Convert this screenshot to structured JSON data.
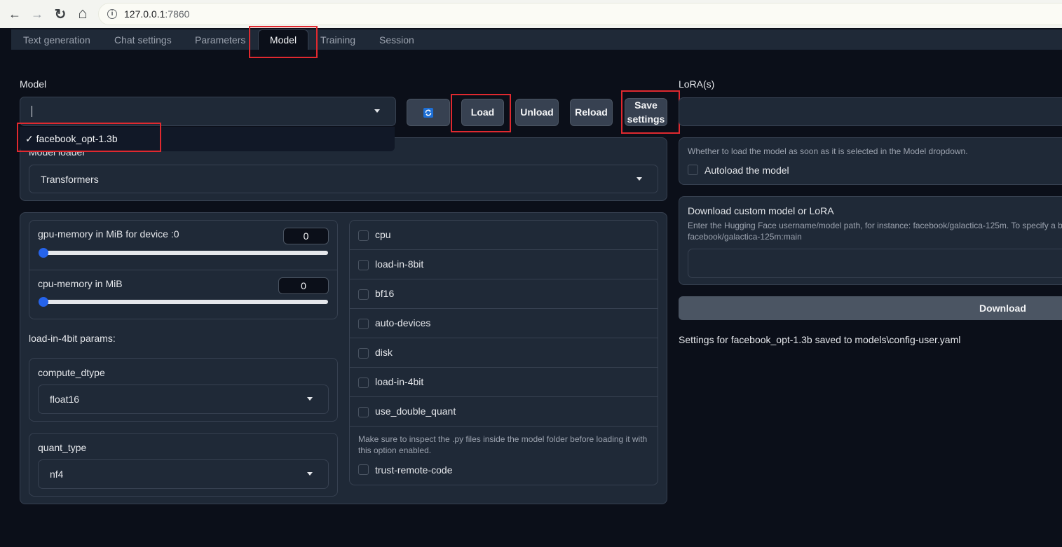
{
  "browser": {
    "url_host": "127.0.0.1",
    "url_port": ":7860",
    "back_icon": "←",
    "forward_icon": "→",
    "reload_icon": "↻",
    "home_icon": "⌂",
    "info_icon": "i"
  },
  "tabs": [
    {
      "label": "Text generation"
    },
    {
      "label": "Chat settings"
    },
    {
      "label": "Parameters"
    },
    {
      "label": "Model"
    },
    {
      "label": "Training"
    },
    {
      "label": "Session"
    }
  ],
  "model": {
    "label": "Model",
    "input_value": "",
    "dropdown_option": "✓ facebook_opt-1.3b",
    "model_loader_label": "Model loader",
    "model_loader_value": "Transformers"
  },
  "toolbar": {
    "refresh_icon": "refresh-icon",
    "load_label": "Load",
    "unload_label": "Unload",
    "reload_label": "Reload",
    "save_settings_label_1": "Save",
    "save_settings_label_2": "settings"
  },
  "memory": {
    "gpu_label": "gpu-memory in MiB for device :0",
    "gpu_value": "0",
    "cpu_label": "cpu-memory in MiB",
    "cpu_value": "0",
    "params_label": "load-in-4bit params:",
    "compute_dtype_label": "compute_dtype",
    "compute_dtype_value": "float16",
    "quant_type_label": "quant_type",
    "quant_type_value": "nf4"
  },
  "checkboxes": [
    {
      "label": "cpu"
    },
    {
      "label": "load-in-8bit"
    },
    {
      "label": "bf16"
    },
    {
      "label": "auto-devices"
    },
    {
      "label": "disk"
    },
    {
      "label": "load-in-4bit"
    },
    {
      "label": "use_double_quant"
    }
  ],
  "trust": {
    "info": "Make sure to inspect the .py files inside the model folder before loading it with this option enabled.",
    "label": "trust-remote-code"
  },
  "lora": {
    "label": "LoRA(s)",
    "autoload_info": "Whether to load the model as soon as it is selected in the Model dropdown.",
    "autoload_label": "Autoload the model",
    "download_title": "Download custom model or LoRA",
    "download_info_1": "Enter the Hugging Face username/model path, for instance: facebook/galactica-125m. To specify a b",
    "download_info_2": "facebook/galactica-125m:main",
    "download_button": "Download",
    "status": "Settings for facebook_opt-1.3b saved to models\\config-user.yaml"
  },
  "colors": {
    "background": "#0b0f19",
    "panel": "#1f2937",
    "border": "#374151",
    "highlight": "#e0292f",
    "slider_thumb": "#2563eb"
  },
  "slider_levels": {
    "gpu_memory": 0,
    "cpu_memory": 0
  }
}
